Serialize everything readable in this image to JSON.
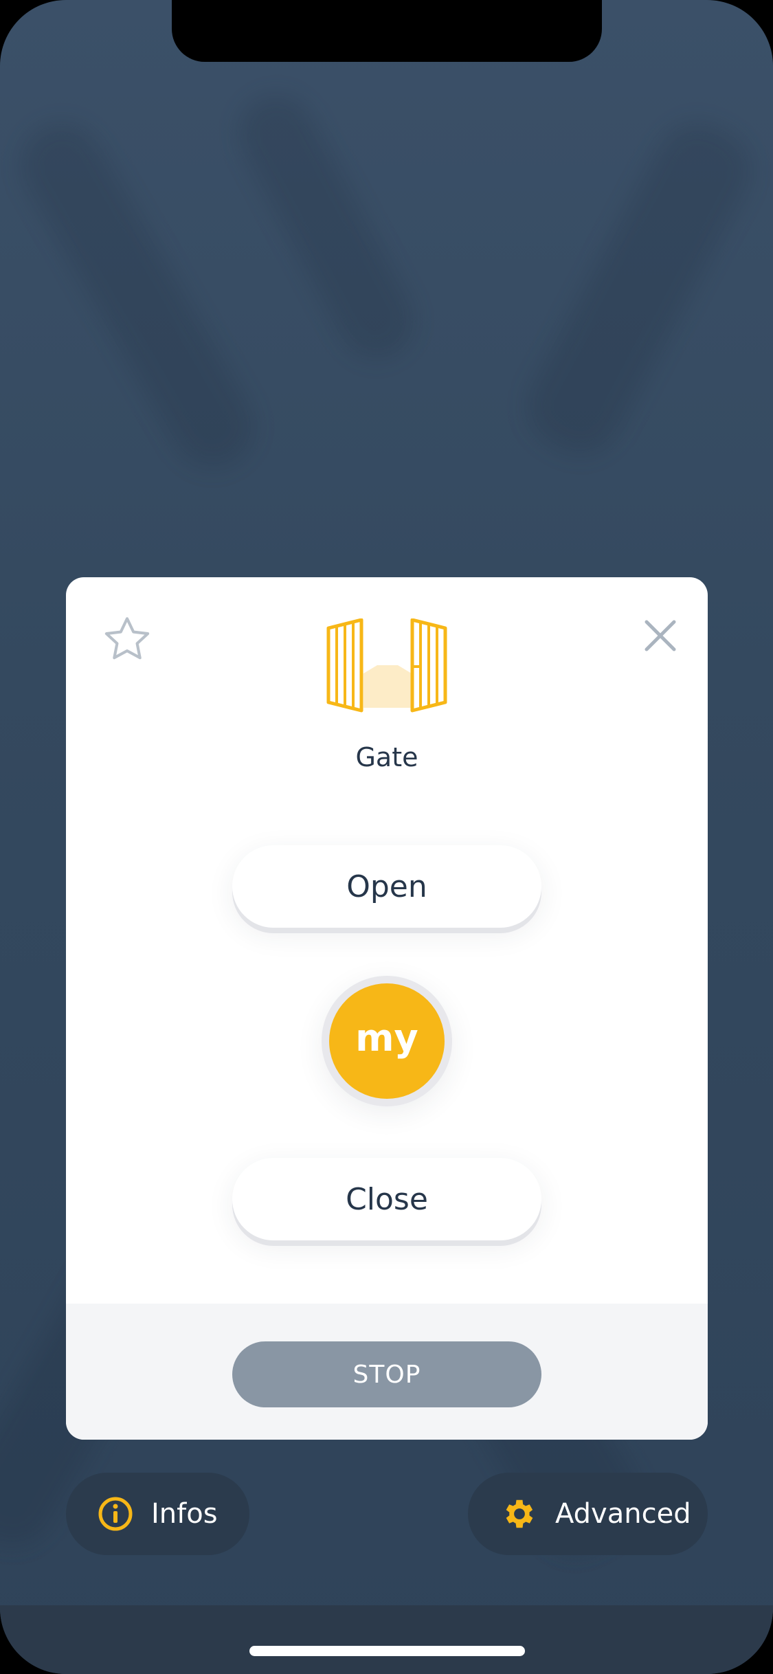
{
  "device": {
    "name": "Gate",
    "icon": "gate-icon"
  },
  "controls": {
    "open_label": "Open",
    "my_label": "my",
    "close_label": "Close",
    "stop_label": "STOP"
  },
  "header_icons": {
    "favorite": "star-icon",
    "dismiss": "close-icon"
  },
  "bottom_bar": {
    "infos_label": "Infos",
    "infos_icon": "info-icon",
    "advanced_label": "Advanced",
    "advanced_icon": "gear-icon"
  },
  "colors": {
    "accent": "#f7b717",
    "background": "#34495f",
    "stop_button": "#8996a4",
    "text_dark": "#26364a"
  }
}
